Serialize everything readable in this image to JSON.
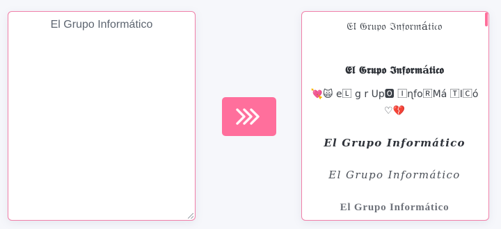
{
  "input": {
    "value": "El Grupo Informático"
  },
  "convert_button": {
    "icon": "triple-chevron-right-icon",
    "color": "#ff6f9c"
  },
  "results": [
    {
      "text": "𝔈𝔩 𝔊𝔯𝔲𝔭𝔬 ℑ𝔫𝔣𝔬𝔯𝔪á𝔱𝔦𝔠𝔬"
    },
    {
      "text": "𝕰𝖑 𝕲𝖗𝖚𝖕𝖔 𝕴𝖓𝖋𝖔𝖗𝖒á𝖙𝖎𝖈𝖔"
    },
    {
      "text": "💘🙀 e🄻 g r Up🅾 🄸ɳfo🅁Má 🅃Ⅰ🄲ó ♡💔"
    },
    {
      "text": "𝑬𝒍 𝑮𝒓𝒖𝒑𝒐 𝑰𝒏𝒇𝒐𝒓𝒎á𝒕𝒊𝒄𝒐"
    },
    {
      "text": "𝐸𝑙 𝐺𝑟𝑢𝑝𝑜 𝐼𝑛𝑓𝑜𝑟𝑚á𝑡𝑖𝑐𝑜"
    },
    {
      "text": "El Grupo Informático"
    }
  ],
  "colors": {
    "accent": "#ff6f9c",
    "border": "#f07fa8"
  }
}
